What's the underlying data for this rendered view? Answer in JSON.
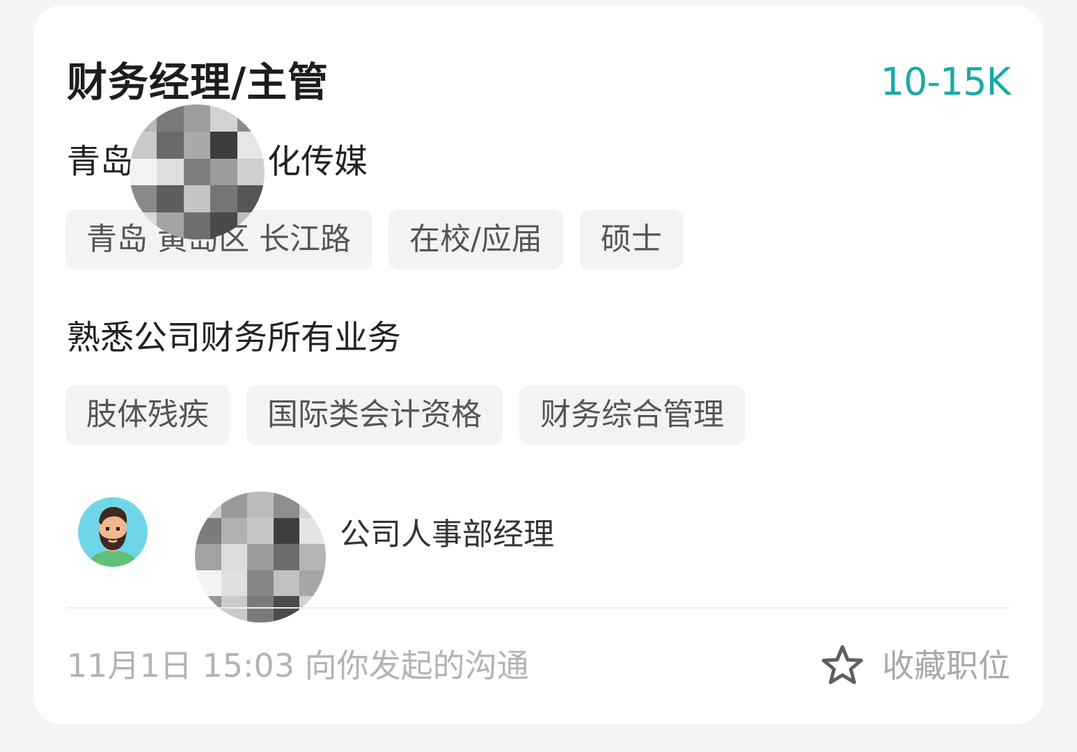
{
  "job": {
    "title": "财务经理/主管",
    "salary": "10-15K",
    "company": "青岛　　　　化传媒",
    "tags": [
      "青岛 黄岛区 长江路",
      "在校/应届",
      "硕士"
    ],
    "description": "熟悉公司财务所有业务",
    "skills": [
      "肢体残疾",
      "国际类会计资格",
      "财务综合管理"
    ]
  },
  "recruiter": {
    "avatar_icon": "bearded-man-avatar",
    "title": "公司人事部经理"
  },
  "footer": {
    "time_text": "11月1日 15:03 向你发起的沟通",
    "favorite_label": "收藏职位",
    "favorite_icon": "star-outline-icon"
  },
  "colors": {
    "salary": "#19aaa9",
    "background": "#f4f4f4",
    "card": "#ffffff",
    "tag_bg": "#f3f3f3"
  }
}
